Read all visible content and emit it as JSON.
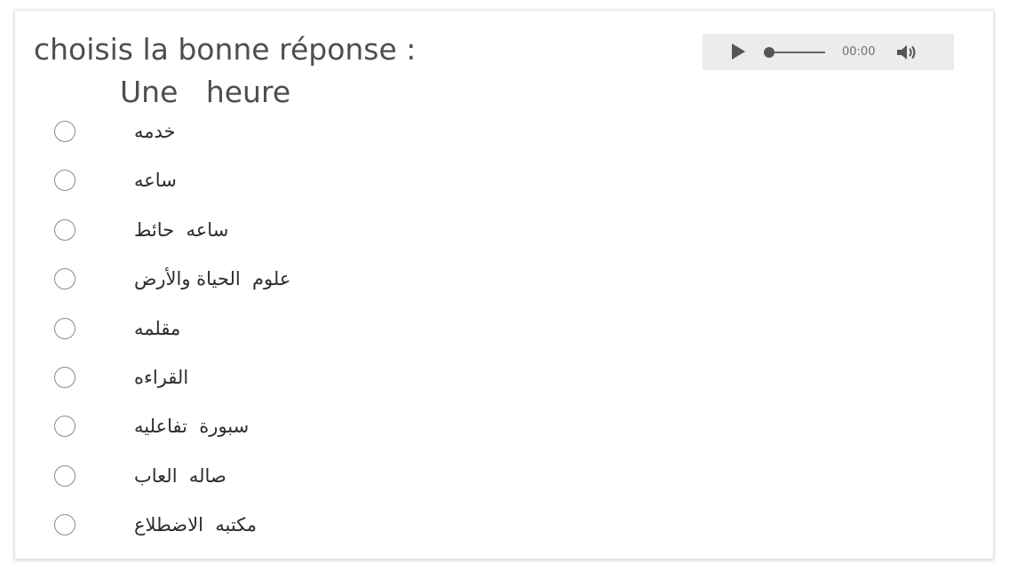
{
  "question": {
    "instruction": "choisis la bonne réponse :",
    "prompt": "Une   heure"
  },
  "audio": {
    "time": "00:00",
    "play_icon": "play-icon",
    "volume_icon": "volume-icon",
    "progress": 0
  },
  "options": [
    {
      "label": "خدمه"
    },
    {
      "label": " ساعه"
    },
    {
      "label": "ساعه  حائط"
    },
    {
      "label": "علوم  الحياة والأرض"
    },
    {
      "label": "مقلمه"
    },
    {
      "label": "القراءه"
    },
    {
      "label": "سبورة  تفاعليه"
    },
    {
      "label": "صاله  العاب"
    },
    {
      "label": "مكتبه  الاضطلاع"
    }
  ],
  "colors": {
    "text": "#4e4e4e",
    "player_bg": "#ececec",
    "radio_border": "#8a8a8a"
  }
}
